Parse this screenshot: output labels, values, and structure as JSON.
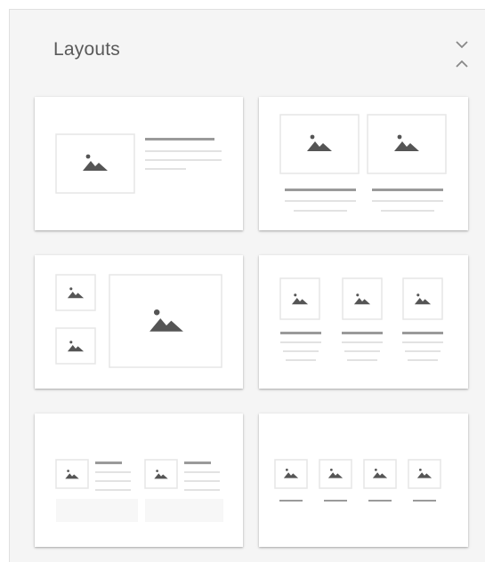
{
  "panel": {
    "title": "Layouts"
  },
  "icons": {
    "collapse": "chevron-collapse-icon",
    "image": "image-placeholder-icon"
  },
  "colors": {
    "panel_bg": "#f5f5f5",
    "card_bg": "#ffffff",
    "frame": "#e6e6e6",
    "icon": "#555555",
    "line_dark": "#9a9a9a",
    "line_light": "#e2e2e2"
  },
  "layouts": [
    {
      "name": "image-left-text-right"
    },
    {
      "name": "two-images-with-captions"
    },
    {
      "name": "small-images-and-large-image"
    },
    {
      "name": "three-images-with-captions"
    },
    {
      "name": "two-image-text-pairs"
    },
    {
      "name": "four-images-with-captions"
    }
  ]
}
